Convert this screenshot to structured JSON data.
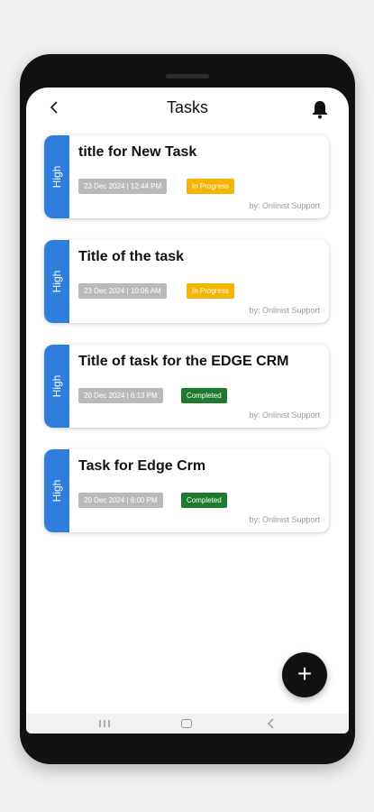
{
  "header": {
    "back_icon": "chevron-left-icon",
    "title": "Tasks",
    "bell_icon": "bell-icon"
  },
  "tasks": [
    {
      "priority": "High",
      "title": "title for New Task",
      "date": "23 Dec 2024 | 12:44 PM",
      "status": "In Progress",
      "byline": "by: Onlinist Support"
    },
    {
      "priority": "High",
      "title": "Title of the task",
      "date": "23 Dec 2024 | 10:06 AM",
      "status": "In Progress",
      "byline": "by: Onlinist Support"
    },
    {
      "priority": "High",
      "title": "Title of task for the EDGE CRM",
      "date": "20 Dec 2024 | 6:13 PM",
      "status": "Completed",
      "byline": "by: Onlinist Support"
    },
    {
      "priority": "High",
      "title": "Task for Edge Crm",
      "date": "20 Dec 2024 | 6:00 PM",
      "status": "Completed",
      "byline": "by: Onlinist Support"
    }
  ],
  "fab": {
    "label": "+",
    "icon": "plus-icon"
  },
  "colors": {
    "priority_high": "#2f7ddd",
    "status_in_progress": "#f4b400",
    "status_completed": "#1e7b2e",
    "date_chip": "#b9b9b9"
  }
}
